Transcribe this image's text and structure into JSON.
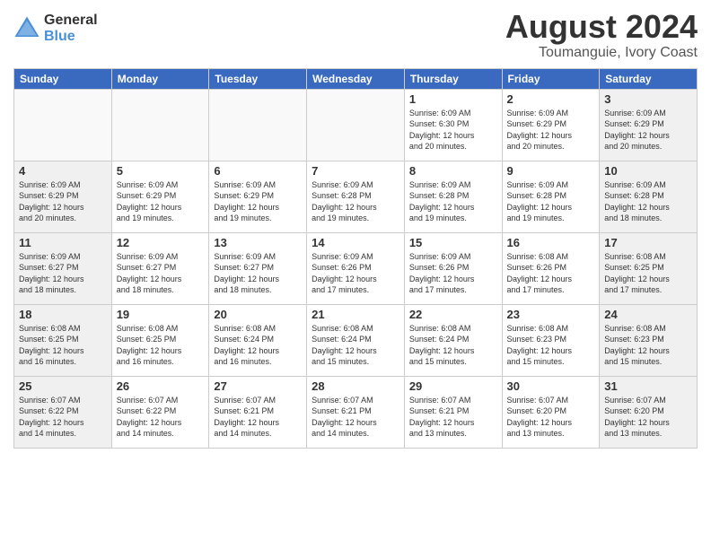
{
  "header": {
    "logo": {
      "general": "General",
      "blue": "Blue"
    },
    "title": "August 2024",
    "subtitle": "Toumanguie, Ivory Coast"
  },
  "weekdays": [
    "Sunday",
    "Monday",
    "Tuesday",
    "Wednesday",
    "Thursday",
    "Friday",
    "Saturday"
  ],
  "weeks": [
    [
      {
        "day": "",
        "info": ""
      },
      {
        "day": "",
        "info": ""
      },
      {
        "day": "",
        "info": ""
      },
      {
        "day": "",
        "info": ""
      },
      {
        "day": "1",
        "info": "Sunrise: 6:09 AM\nSunset: 6:30 PM\nDaylight: 12 hours\nand 20 minutes."
      },
      {
        "day": "2",
        "info": "Sunrise: 6:09 AM\nSunset: 6:29 PM\nDaylight: 12 hours\nand 20 minutes."
      },
      {
        "day": "3",
        "info": "Sunrise: 6:09 AM\nSunset: 6:29 PM\nDaylight: 12 hours\nand 20 minutes."
      }
    ],
    [
      {
        "day": "4",
        "info": "Sunrise: 6:09 AM\nSunset: 6:29 PM\nDaylight: 12 hours\nand 20 minutes."
      },
      {
        "day": "5",
        "info": "Sunrise: 6:09 AM\nSunset: 6:29 PM\nDaylight: 12 hours\nand 19 minutes."
      },
      {
        "day": "6",
        "info": "Sunrise: 6:09 AM\nSunset: 6:29 PM\nDaylight: 12 hours\nand 19 minutes."
      },
      {
        "day": "7",
        "info": "Sunrise: 6:09 AM\nSunset: 6:28 PM\nDaylight: 12 hours\nand 19 minutes."
      },
      {
        "day": "8",
        "info": "Sunrise: 6:09 AM\nSunset: 6:28 PM\nDaylight: 12 hours\nand 19 minutes."
      },
      {
        "day": "9",
        "info": "Sunrise: 6:09 AM\nSunset: 6:28 PM\nDaylight: 12 hours\nand 19 minutes."
      },
      {
        "day": "10",
        "info": "Sunrise: 6:09 AM\nSunset: 6:28 PM\nDaylight: 12 hours\nand 18 minutes."
      }
    ],
    [
      {
        "day": "11",
        "info": "Sunrise: 6:09 AM\nSunset: 6:27 PM\nDaylight: 12 hours\nand 18 minutes."
      },
      {
        "day": "12",
        "info": "Sunrise: 6:09 AM\nSunset: 6:27 PM\nDaylight: 12 hours\nand 18 minutes."
      },
      {
        "day": "13",
        "info": "Sunrise: 6:09 AM\nSunset: 6:27 PM\nDaylight: 12 hours\nand 18 minutes."
      },
      {
        "day": "14",
        "info": "Sunrise: 6:09 AM\nSunset: 6:26 PM\nDaylight: 12 hours\nand 17 minutes."
      },
      {
        "day": "15",
        "info": "Sunrise: 6:09 AM\nSunset: 6:26 PM\nDaylight: 12 hours\nand 17 minutes."
      },
      {
        "day": "16",
        "info": "Sunrise: 6:08 AM\nSunset: 6:26 PM\nDaylight: 12 hours\nand 17 minutes."
      },
      {
        "day": "17",
        "info": "Sunrise: 6:08 AM\nSunset: 6:25 PM\nDaylight: 12 hours\nand 17 minutes."
      }
    ],
    [
      {
        "day": "18",
        "info": "Sunrise: 6:08 AM\nSunset: 6:25 PM\nDaylight: 12 hours\nand 16 minutes."
      },
      {
        "day": "19",
        "info": "Sunrise: 6:08 AM\nSunset: 6:25 PM\nDaylight: 12 hours\nand 16 minutes."
      },
      {
        "day": "20",
        "info": "Sunrise: 6:08 AM\nSunset: 6:24 PM\nDaylight: 12 hours\nand 16 minutes."
      },
      {
        "day": "21",
        "info": "Sunrise: 6:08 AM\nSunset: 6:24 PM\nDaylight: 12 hours\nand 15 minutes."
      },
      {
        "day": "22",
        "info": "Sunrise: 6:08 AM\nSunset: 6:24 PM\nDaylight: 12 hours\nand 15 minutes."
      },
      {
        "day": "23",
        "info": "Sunrise: 6:08 AM\nSunset: 6:23 PM\nDaylight: 12 hours\nand 15 minutes."
      },
      {
        "day": "24",
        "info": "Sunrise: 6:08 AM\nSunset: 6:23 PM\nDaylight: 12 hours\nand 15 minutes."
      }
    ],
    [
      {
        "day": "25",
        "info": "Sunrise: 6:07 AM\nSunset: 6:22 PM\nDaylight: 12 hours\nand 14 minutes."
      },
      {
        "day": "26",
        "info": "Sunrise: 6:07 AM\nSunset: 6:22 PM\nDaylight: 12 hours\nand 14 minutes."
      },
      {
        "day": "27",
        "info": "Sunrise: 6:07 AM\nSunset: 6:21 PM\nDaylight: 12 hours\nand 14 minutes."
      },
      {
        "day": "28",
        "info": "Sunrise: 6:07 AM\nSunset: 6:21 PM\nDaylight: 12 hours\nand 14 minutes."
      },
      {
        "day": "29",
        "info": "Sunrise: 6:07 AM\nSunset: 6:21 PM\nDaylight: 12 hours\nand 13 minutes."
      },
      {
        "day": "30",
        "info": "Sunrise: 6:07 AM\nSunset: 6:20 PM\nDaylight: 12 hours\nand 13 minutes."
      },
      {
        "day": "31",
        "info": "Sunrise: 6:07 AM\nSunset: 6:20 PM\nDaylight: 12 hours\nand 13 minutes."
      }
    ]
  ]
}
